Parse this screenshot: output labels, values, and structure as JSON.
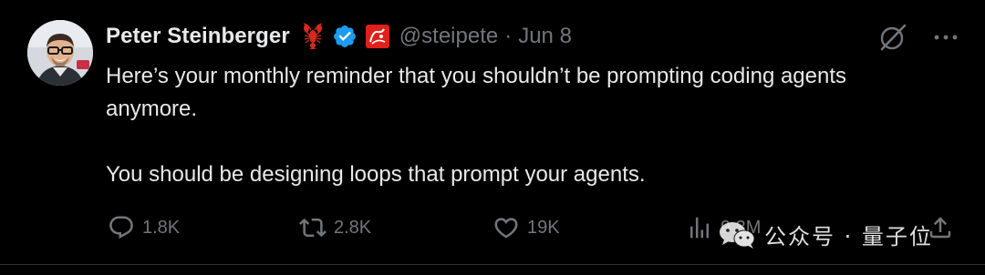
{
  "author": {
    "name": "Peter Steinberger",
    "handle": "@steipete",
    "separator": "·",
    "date": "Jun 8"
  },
  "tweet": {
    "paragraphs": [
      "Here’s your monthly reminder that you shouldn’t be prompting coding agents anymore.",
      "You should be designing loops that prompt your agents."
    ]
  },
  "actions": {
    "replies": "1.8K",
    "reposts": "2.8K",
    "likes": "19K",
    "views": "9.3M"
  },
  "watermark": {
    "text": "公众号 · 量子位"
  },
  "colors": {
    "background": "#000000",
    "text_primary": "#e7e9ea",
    "text_secondary": "#71767b",
    "verified_blue": "#1d9bf0",
    "badge_red": "#e0201b"
  },
  "icons": {
    "verified": "verified-badge-icon",
    "lobster": "lobster-emoji-icon",
    "affiliate": "affiliate-badge-icon",
    "grok": "grok-icon",
    "more": "more-icon",
    "reply": "reply-icon",
    "repost": "repost-icon",
    "like": "heart-icon",
    "views": "views-icon",
    "wechat": "wechat-icon"
  }
}
